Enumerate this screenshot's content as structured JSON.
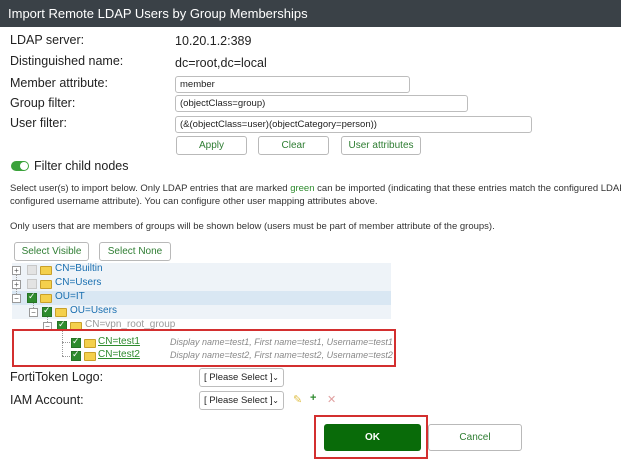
{
  "dialog": {
    "title": "Import Remote LDAP Users by Group Memberships"
  },
  "form": {
    "ldap_server_label": "LDAP server:",
    "ldap_server_value": "10.20.1.2:389",
    "dn_label": "Distinguished name:",
    "dn_value": "dc=root,dc=local",
    "member_attr_label": "Member attribute:",
    "member_attr_value": "member",
    "group_filter_label": "Group filter:",
    "group_filter_value": "(objectClass=group)",
    "user_filter_label": "User filter:",
    "user_filter_value": "(&(objectClass=user)(objectCategory=person))"
  },
  "buttons": {
    "apply": "Apply",
    "clear": "Clear",
    "user_attributes": "User attributes",
    "select_visible": "Select Visible",
    "select_none": "Select None",
    "ok": "OK",
    "cancel": "Cancel"
  },
  "filter_child": {
    "label": "Filter child nodes",
    "enabled": true
  },
  "description": {
    "line1_pre": "Select user(s) to import below. Only LDAP entries that are marked ",
    "line1_green": "green",
    "line1_post": " can be imported (indicating that these entries match the configured LDAP",
    "line2": "configured username attribute). You can configure other user mapping attributes above.",
    "line3": "Only users that are members of groups will be shown below (users must be part of member attribute of the groups)."
  },
  "tree": {
    "builtin": "CN=Builtin",
    "users_cn": "CN=Users",
    "ou_it": "OU=IT",
    "ou_users": "OU=Users",
    "group": "CN=vpn_root_group",
    "user1": {
      "label": "CN=test1",
      "desc": "Display name=test1, First name=test1, Username=test1"
    },
    "user2": {
      "label": "CN=test2",
      "desc": "Display name=test2, First name=test2, Username=test2"
    }
  },
  "fortitoken": {
    "label": "FortiToken Logo:",
    "value": "[ Please Select ]"
  },
  "iam": {
    "label": "IAM Account:",
    "value": "[ Please Select ]"
  },
  "colors": {
    "title_bar": "#3a4147",
    "accent_green": "#2e8b2e",
    "ok_button": "#096b09",
    "highlight_red": "#d32f2f"
  }
}
